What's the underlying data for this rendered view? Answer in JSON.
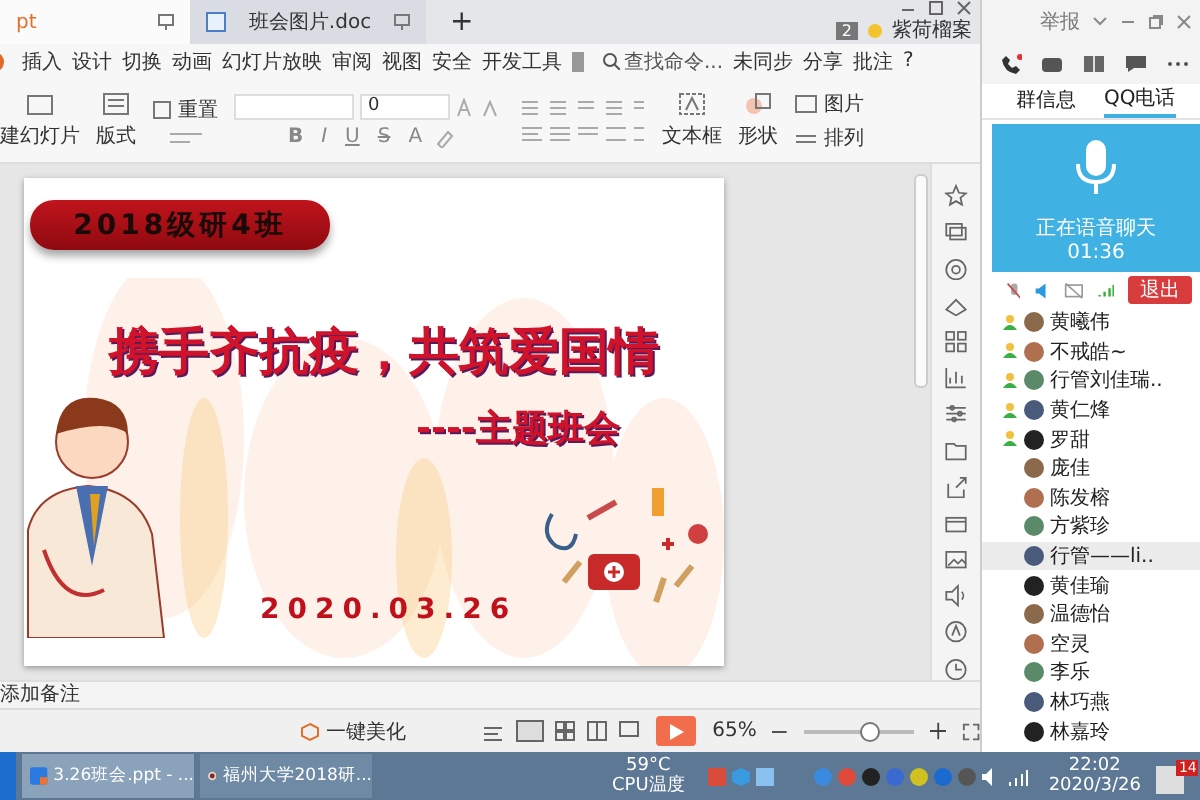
{
  "app": {
    "tabs": [
      {
        "label": "pt",
        "selected": true
      },
      {
        "label": "班会图片.doc",
        "selected": false
      }
    ],
    "new_tab": "+",
    "window_count": "2",
    "user": "紫荷榴案",
    "menu": [
      "插入",
      "设计",
      "切换",
      "动画",
      "幻灯片放映",
      "审阅",
      "视图",
      "安全",
      "开发工具"
    ],
    "search": {
      "placeholder": "查找命令..."
    },
    "actions": [
      "未同步",
      "分享",
      "批注",
      "?"
    ],
    "toolbar": {
      "new_slide": "建幻灯片",
      "layout": "版式",
      "reset": "重置",
      "font_size": "0",
      "format": [
        "B",
        "I",
        "U",
        "S",
        "A"
      ],
      "textbox": "文本框",
      "shape": "形状",
      "picture": "图片",
      "arrange": "排列"
    }
  },
  "slide": {
    "class_label": "2018级研4班",
    "title": "携手齐抗疫，共筑爱国情",
    "subtitle": "----主题班会",
    "date": "2020.03.26"
  },
  "notes": {
    "placeholder": "添加备注"
  },
  "status_bar": {
    "beautify": "一键美化",
    "zoom": "65%",
    "zoom_slider": {
      "level": 0.6
    }
  },
  "qq": {
    "report": "举报",
    "tabs": [
      {
        "label": "群信息",
        "selected": false
      },
      {
        "label": "QQ电话",
        "selected": true
      }
    ],
    "call": {
      "status": "正在语音聊天",
      "time": "01:36",
      "exit": "退出"
    },
    "members": [
      {
        "name": "黄曦伟",
        "speaking": true,
        "selected": false
      },
      {
        "name": "不戒皓~",
        "speaking": true,
        "selected": false
      },
      {
        "name": "行管刘佳瑞..",
        "speaking": true,
        "selected": false
      },
      {
        "name": "黄仁烽",
        "speaking": true,
        "selected": false
      },
      {
        "name": "罗甜",
        "speaking": true,
        "selected": false
      },
      {
        "name": "庞佳",
        "speaking": false,
        "selected": false
      },
      {
        "name": "陈发榕",
        "speaking": false,
        "selected": false
      },
      {
        "name": "方紫珍",
        "speaking": false,
        "selected": false
      },
      {
        "name": "行管——li..",
        "speaking": false,
        "selected": true
      },
      {
        "name": "黄佳瑜",
        "speaking": false,
        "selected": false
      },
      {
        "name": "温德怡",
        "speaking": false,
        "selected": false
      },
      {
        "name": "空灵",
        "speaking": false,
        "selected": false
      },
      {
        "name": "李乐",
        "speaking": false,
        "selected": false
      },
      {
        "name": "林巧燕",
        "speaking": false,
        "selected": false
      },
      {
        "name": "林嘉玲",
        "speaking": false,
        "selected": false
      }
    ]
  },
  "taskbar": {
    "apps": [
      {
        "label": "3.26班会.ppt - ...",
        "selected": true
      },
      {
        "label": "福州大学2018研...",
        "selected": false
      }
    ],
    "temperature": "59°C",
    "temperature_label": "CPU温度",
    "time": "22:02",
    "date": "2020/3/26",
    "notifications": "14"
  }
}
